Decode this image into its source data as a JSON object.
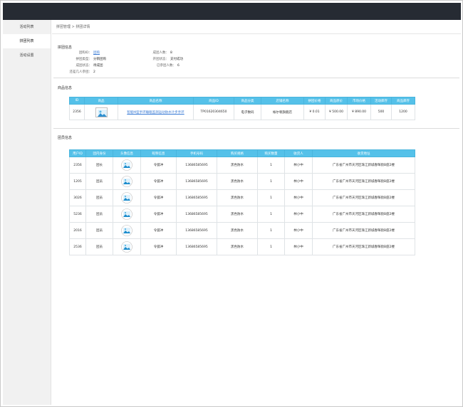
{
  "sidebar": {
    "items": [
      {
        "label": "活动列表"
      },
      {
        "label": "拼团列表"
      },
      {
        "label": "活动设置"
      }
    ]
  },
  "breadcrumb": {
    "parent": "拼团管理",
    "separator": ">",
    "current": "拼团详情"
  },
  "group_info": {
    "title": "拼团信息",
    "left": [
      {
        "key": "团购ID：",
        "value": "团购",
        "link": true
      },
      {
        "key": "拼团类型：",
        "value": "分销团购"
      },
      {
        "key": "成团状态：",
        "value": "待成团"
      },
      {
        "key": "还差几人参团：",
        "value": "2"
      }
    ],
    "right": [
      {
        "key": "成团人数：",
        "value": "8"
      },
      {
        "key": "开团状态：",
        "value": "支付成功"
      },
      {
        "key": "已参团人数：",
        "value": "6"
      }
    ]
  },
  "goods": {
    "title": "商品信息",
    "headers": [
      "ID",
      "商品",
      "商品名称",
      "商品ID",
      "商品分类",
      "店铺名称",
      "拼团价格",
      "商品原价",
      "市场价格",
      "活动库存",
      "商品库存"
    ],
    "row": {
      "id": "2356",
      "thumb_icon": "image-placeholder-icon",
      "name": "智能M型手环睡眠监测运动防水计步手环",
      "goods_id": "TP01620304650",
      "category": "电子数码",
      "shop": "帐尔顿旗舰店",
      "group_price": "¥ 0.01",
      "original_price": "¥ 500.00",
      "market_price": "¥ 890.00",
      "activity_stock": "500",
      "goods_stock": "1200"
    }
  },
  "members": {
    "title": "团员信息",
    "headers": [
      "用户ID",
      "团内身份",
      "头像信息",
      "昵称信息",
      "手机号码",
      "购买规格",
      "购买数量",
      "收货人",
      "收货地址"
    ],
    "rows": [
      {
        "uid": "2356",
        "role": "团长",
        "avatar_icon": "user-avatar-icon",
        "nickname": "令狐冲",
        "phone": "13686585695",
        "spec": "黑色防水",
        "qty": "1",
        "receiver": "林小中",
        "address": "广东省广州市天河区珠江新城春晖街B座2楼"
      },
      {
        "uid": "1205",
        "role": "团员",
        "avatar_icon": "user-avatar-icon",
        "nickname": "令狐冲",
        "phone": "13686585695",
        "spec": "黑色防水",
        "qty": "1",
        "receiver": "林小中",
        "address": "广东省广州市天河区珠江新城春晖街B座2楼"
      },
      {
        "uid": "3026",
        "role": "团员",
        "avatar_icon": "user-avatar-icon",
        "nickname": "令狐冲",
        "phone": "13686585695",
        "spec": "黑色防水",
        "qty": "1",
        "receiver": "林小中",
        "address": "广东省广州市天河区珠江新城春晖街B座2楼"
      },
      {
        "uid": "5236",
        "role": "团员",
        "avatar_icon": "user-avatar-icon",
        "nickname": "令狐冲",
        "phone": "13686585695",
        "spec": "黑色防水",
        "qty": "1",
        "receiver": "林小中",
        "address": "广东省广州市天河区珠江新城春晖街B座2楼"
      },
      {
        "uid": "2016",
        "role": "团员",
        "avatar_icon": "user-avatar-icon",
        "nickname": "令狐冲",
        "phone": "13686585695",
        "spec": "黑色防水",
        "qty": "1",
        "receiver": "林小中",
        "address": "广东省广州市天河区珠江新城春晖街B座2楼"
      },
      {
        "uid": "2536",
        "role": "团员",
        "avatar_icon": "user-avatar-icon",
        "nickname": "令狐冲",
        "phone": "13686585695",
        "spec": "黑色防水",
        "qty": "1",
        "receiver": "林小中",
        "address": "广东省广州市天河区珠江新城春晖街B座2楼"
      }
    ]
  },
  "colors": {
    "topbar": "#262b33",
    "table_header": "#55c1e9",
    "link": "#3a7bd5",
    "sidebar": "#f1f1f1"
  }
}
